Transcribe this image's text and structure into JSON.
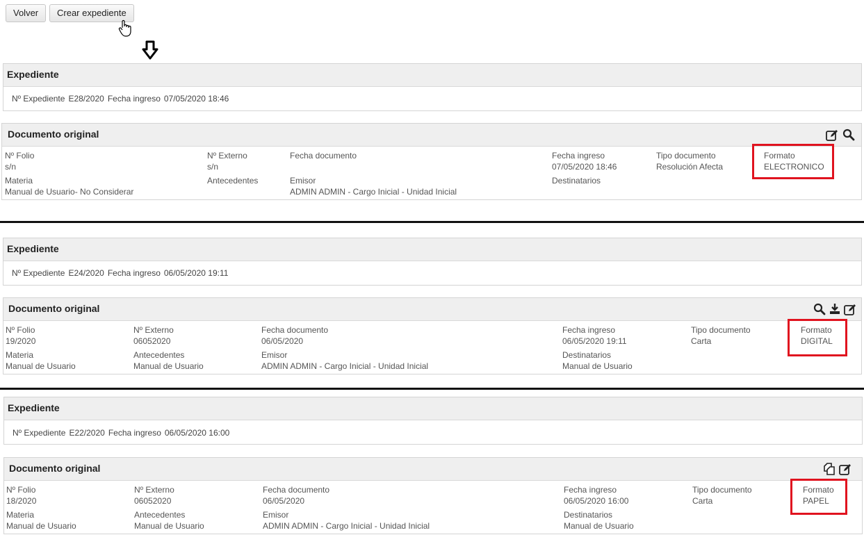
{
  "toolbar": {
    "back_label": "Volver",
    "create_label": "Crear expediente"
  },
  "blocks": [
    {
      "expediente": {
        "title": "Expediente",
        "num_label": "Nº Expediente",
        "num": "E28/2020",
        "date_label": "Fecha ingreso",
        "date": "07/05/2020 18:46"
      },
      "documento": {
        "title": "Documento original",
        "icons": [
          "edit-icon",
          "search-icon"
        ],
        "folio_label": "Nº Folio",
        "folio": "s/n",
        "externo_label": "Nº Externo",
        "externo": "s/n",
        "fecha_doc_label": "Fecha documento",
        "fecha_doc": "",
        "fecha_ing_label": "Fecha ingreso",
        "fecha_ing": "07/05/2020 18:46",
        "tipo_label": "Tipo documento",
        "tipo": "Resolución Afecta",
        "formato_label": "Formato",
        "formato": "ELECTRONICO",
        "materia_label": "Materia",
        "materia": "Manual de Usuario- No Considerar",
        "antecedentes_label": "Antecedentes",
        "antecedentes": "",
        "emisor_label": "Emisor",
        "emisor": "ADMIN ADMIN - Cargo Inicial - Unidad Inicial",
        "destinatarios_label": "Destinatarios",
        "destinatarios": ""
      }
    },
    {
      "expediente": {
        "title": "Expediente",
        "num_label": "Nº Expediente",
        "num": "E24/2020",
        "date_label": "Fecha ingreso",
        "date": "06/05/2020 19:11"
      },
      "documento": {
        "title": "Documento original",
        "icons": [
          "search-icon",
          "download-icon",
          "edit-icon"
        ],
        "folio_label": "Nº Folio",
        "folio": "19/2020",
        "externo_label": "Nº Externo",
        "externo": "06052020",
        "fecha_doc_label": "Fecha documento",
        "fecha_doc": "06/05/2020",
        "fecha_ing_label": "Fecha ingreso",
        "fecha_ing": "06/05/2020 19:11",
        "tipo_label": "Tipo documento",
        "tipo": "Carta",
        "formato_label": "Formato",
        "formato": "DIGITAL",
        "materia_label": "Materia",
        "materia": "Manual de Usuario",
        "antecedentes_label": "Antecedentes",
        "antecedentes": "Manual de Usuario",
        "emisor_label": "Emisor",
        "emisor": "ADMIN ADMIN - Cargo Inicial - Unidad Inicial",
        "destinatarios_label": "Destinatarios",
        "destinatarios": "Manual de Usuario"
      }
    },
    {
      "expediente": {
        "title": "Expediente",
        "num_label": "Nº Expediente",
        "num": "E22/2020",
        "date_label": "Fecha ingreso",
        "date": "06/05/2020 16:00"
      },
      "documento": {
        "title": "Documento original",
        "icons": [
          "copy-icon",
          "edit-icon"
        ],
        "folio_label": "Nº Folio",
        "folio": "18/2020",
        "externo_label": "Nº Externo",
        "externo": "06052020",
        "fecha_doc_label": "Fecha documento",
        "fecha_doc": "06/05/2020",
        "fecha_ing_label": "Fecha ingreso",
        "fecha_ing": "06/05/2020 16:00",
        "tipo_label": "Tipo documento",
        "tipo": "Carta",
        "formato_label": "Formato",
        "formato": "PAPEL",
        "materia_label": "Materia",
        "materia": "Manual de Usuario",
        "antecedentes_label": "Antecedentes",
        "antecedentes": "Manual de Usuario",
        "emisor_label": "Emisor",
        "emisor": "ADMIN ADMIN - Cargo Inicial - Unidad Inicial",
        "destinatarios_label": "Destinatarios",
        "destinatarios": "Manual de Usuario"
      }
    }
  ],
  "colors": {
    "highlight": "#e0131f",
    "header_bg": "#efefef",
    "separator": "#111111"
  }
}
